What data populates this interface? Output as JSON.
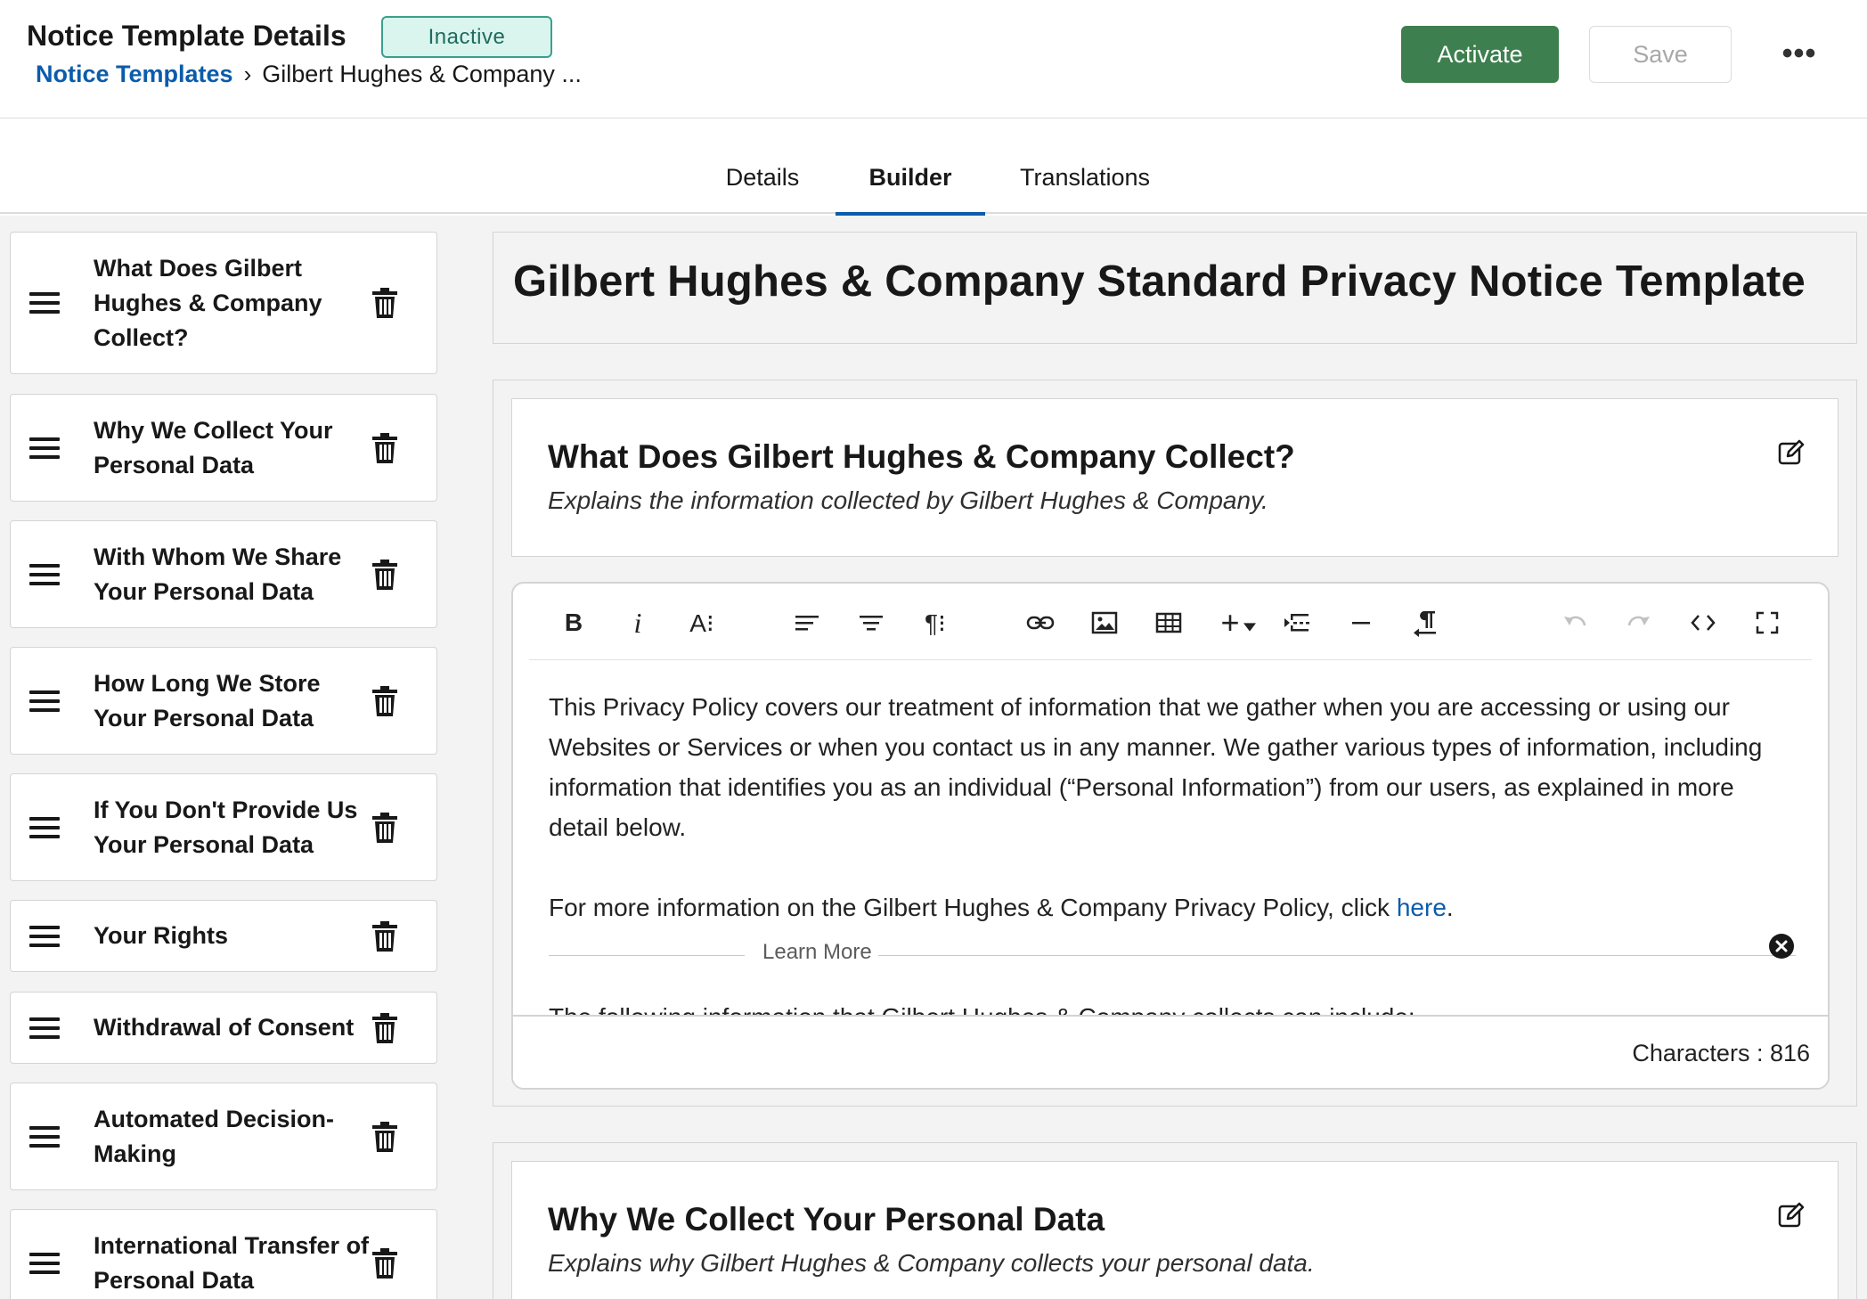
{
  "header": {
    "title": "Notice Template Details",
    "status": "Inactive",
    "breadcrumb_root": "Notice Templates",
    "breadcrumb_separator": "›",
    "breadcrumb_current": "Gilbert Hughes & Company ...",
    "activate_label": "Activate",
    "save_label": "Save",
    "more_label": "•••"
  },
  "tabs": [
    {
      "label": "Details",
      "active": false
    },
    {
      "label": "Builder",
      "active": true
    },
    {
      "label": "Translations",
      "active": false
    }
  ],
  "sidebar": {
    "sections": [
      {
        "label": "What Does Gilbert Hughes & Company Collect?"
      },
      {
        "label": "Why We Collect Your Personal Data"
      },
      {
        "label": "With Whom We Share Your Personal Data"
      },
      {
        "label": "How Long We Store Your Personal Data"
      },
      {
        "label": "If You Don't Provide Us Your Personal Data"
      },
      {
        "label": "Your Rights"
      },
      {
        "label": "Withdrawal of Consent"
      },
      {
        "label": "Automated Decision-Making"
      },
      {
        "label": "International Transfer of Personal Data"
      }
    ]
  },
  "main": {
    "template_title": "Gilbert Hughes & Company Standard Privacy Notice Template",
    "sections": [
      {
        "heading": "What Does Gilbert Hughes & Company Collect?",
        "subtitle": "Explains the information collected by Gilbert Hughes & Company."
      },
      {
        "heading": "Why We Collect Your Personal Data",
        "subtitle": "Explains why Gilbert Hughes & Company collects your personal data."
      }
    ],
    "editor": {
      "toolbar": {
        "bold": "B",
        "italic": "i",
        "font_size": "A⁝",
        "paragraph_format": "¶⁝",
        "insert_more": "+"
      },
      "paragraph1": "This Privacy Policy covers our treatment of information that we gather when you are accessing or using our Websites or Services or when you contact us in any manner. We gather various types of information, including information that identifies you as an individual (“Personal Information”) from our users, as explained in more detail below.",
      "paragraph2_prefix": "For more information on the Gilbert Hughes & Company Privacy Policy, click ",
      "paragraph2_link": "here",
      "paragraph2_suffix": ".",
      "learn_more": "Learn More",
      "clipped_text": "The following information that Gilbert Hughes & Company collects can include:",
      "char_count": "Characters : 816"
    }
  },
  "colors": {
    "accent_blue": "#0b5cab",
    "activate_green": "#3d7f4e",
    "badge_bg": "#d9f5ee",
    "badge_border": "#3ba08c"
  },
  "icons": {
    "drag": "drag-handle-icon",
    "delete": "trash-icon",
    "edit": "edit-icon",
    "remove": "close-circle-icon"
  }
}
